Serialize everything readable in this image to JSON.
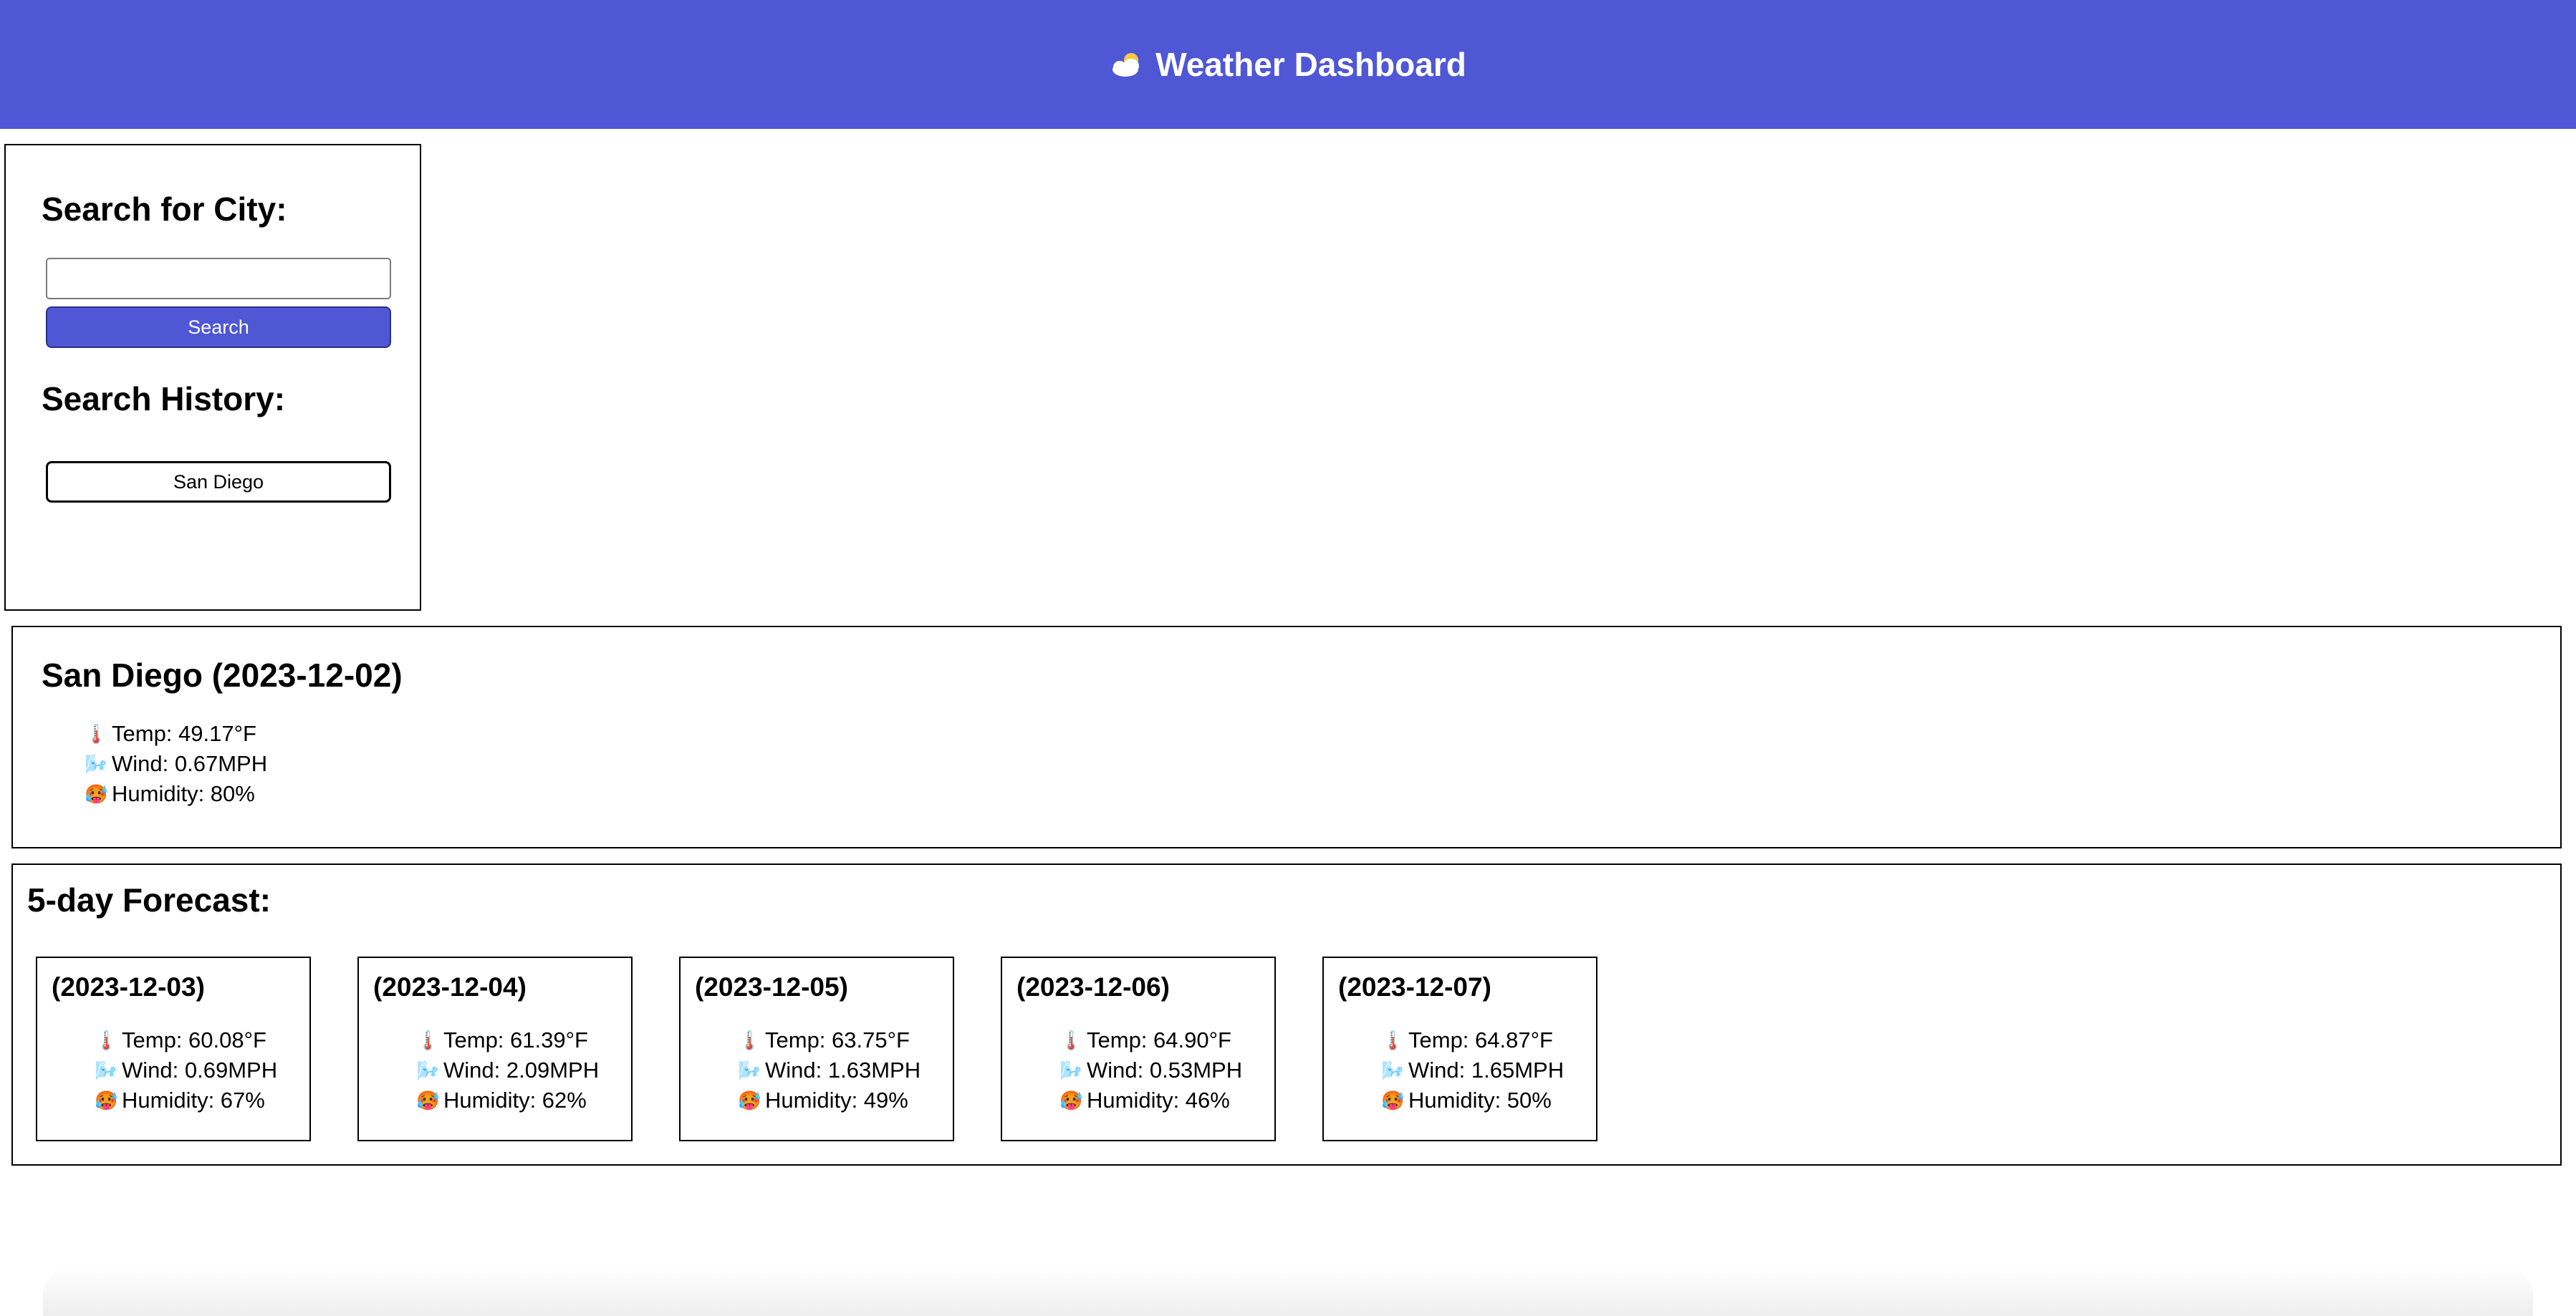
{
  "header": {
    "icon": "sun-behind-cloud-icon",
    "title": "Weather Dashboard",
    "bg_color": "#4f57d5"
  },
  "sidebar": {
    "search_heading": "Search for City:",
    "search_input_value": "",
    "search_button_label": "Search",
    "history_heading": "Search History:",
    "history": [
      "San Diego"
    ]
  },
  "current": {
    "title": "San Diego (2023-12-02)",
    "temp": "Temp: 49.17°F",
    "wind": "Wind: 0.67MPH",
    "humidity": "Humidity: 80%"
  },
  "forecast": {
    "heading": "5-day Forecast:",
    "days": [
      {
        "date": "(2023-12-03)",
        "temp": "Temp: 60.08°F",
        "wind": "Wind: 0.69MPH",
        "humidity": "Humidity: 67%"
      },
      {
        "date": "(2023-12-04)",
        "temp": "Temp: 61.39°F",
        "wind": "Wind: 2.09MPH",
        "humidity": "Humidity: 62%"
      },
      {
        "date": "(2023-12-05)",
        "temp": "Temp: 63.75°F",
        "wind": "Wind: 1.63MPH",
        "humidity": "Humidity: 49%"
      },
      {
        "date": "(2023-12-06)",
        "temp": "Temp: 64.90°F",
        "wind": "Wind: 0.53MPH",
        "humidity": "Humidity: 46%"
      },
      {
        "date": "(2023-12-07)",
        "temp": "Temp: 64.87°F",
        "wind": "Wind: 1.65MPH",
        "humidity": "Humidity: 50%"
      }
    ]
  },
  "icons": {
    "temp": "thermometer-icon",
    "wind": "wind-face-icon",
    "humidity": "hot-face-icon"
  }
}
